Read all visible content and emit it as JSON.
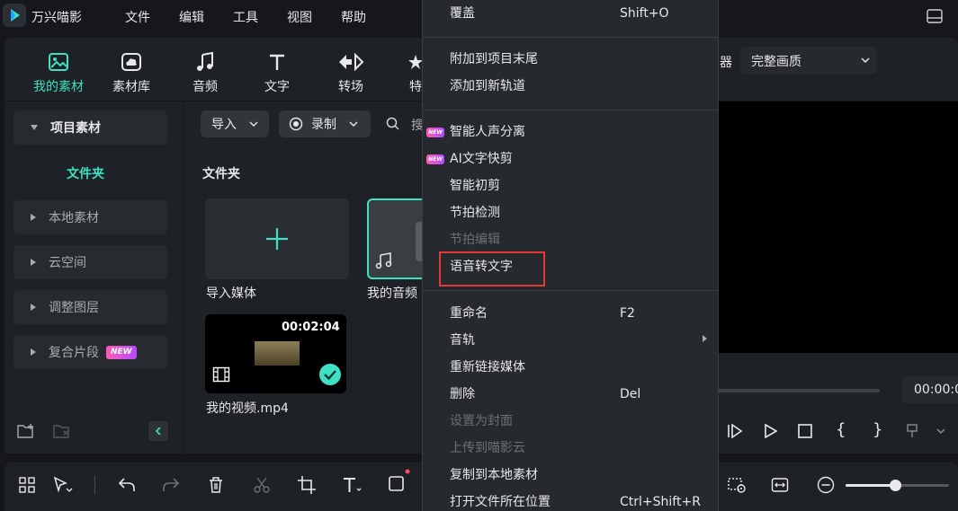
{
  "app": {
    "title": "万兴喵影"
  },
  "menubar": [
    "文件",
    "编辑",
    "工具",
    "视图",
    "帮助"
  ],
  "toolbar": {
    "tabs": [
      {
        "label": "我的素材",
        "icon": "media-icon",
        "active": true
      },
      {
        "label": "素材库",
        "icon": "cloud-library-icon"
      },
      {
        "label": "音频",
        "icon": "music-note-icon"
      },
      {
        "label": "文字",
        "icon": "text-icon"
      },
      {
        "label": "转场",
        "icon": "transition-icon"
      },
      {
        "label": "特",
        "icon": "effects-icon"
      }
    ],
    "preview_right_label": "器",
    "quality": "完整画质"
  },
  "sidebar": {
    "project_media": "项目素材",
    "folder": "文件夹",
    "items": [
      "本地素材",
      "云空间",
      "调整图层",
      "复合片段"
    ],
    "new_badge": "NEW"
  },
  "media": {
    "import_label": "导入",
    "record_label": "录制",
    "search_placeholder": "搜",
    "folder_title": "文件夹",
    "import_media_label": "导入媒体",
    "my_audio_label": "我的音频",
    "video": {
      "duration": "00:02:04",
      "name": "我的视频.mp4"
    }
  },
  "preview": {
    "timecode": "00:00:0"
  },
  "context_menu": {
    "overwrite": {
      "label": "覆盖",
      "shortcut": "Shift+O"
    },
    "append_to_end": "附加到项目末尾",
    "add_to_new_track": "添加到新轨道",
    "ai_vocal_separation": "智能人声分离",
    "ai_text_edit": "AI文字快剪",
    "smart_cut": "智能初剪",
    "beat_detection": "节拍检测",
    "beat_edit": "节拍编辑",
    "speech_to_text": "语音转文字",
    "rename": {
      "label": "重命名",
      "shortcut": "F2"
    },
    "audio_track": "音轨",
    "relink_media": "重新链接媒体",
    "delete": {
      "label": "删除",
      "shortcut": "Del"
    },
    "set_as_cover": "设置为封面",
    "upload_to_cloud": "上传到喵影云",
    "copy_to_local": "复制到本地素材",
    "open_file_location": {
      "label": "打开文件所在位置",
      "shortcut": "Ctrl+Shift+R"
    },
    "new_tag": "NEW"
  },
  "colors": {
    "accent": "#3fe0c3",
    "highlight_box": "#e53935"
  }
}
